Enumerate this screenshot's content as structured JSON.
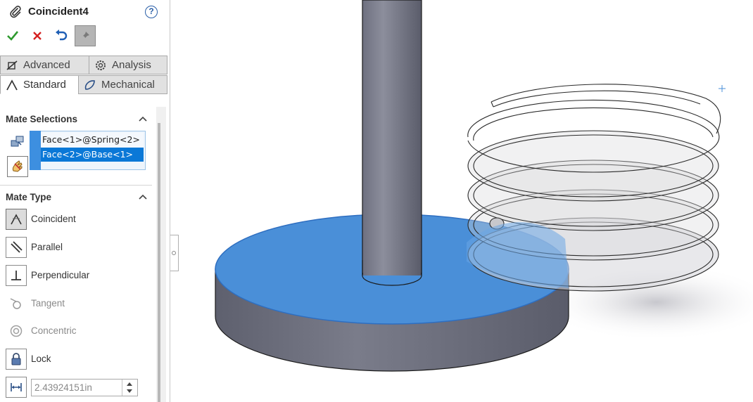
{
  "window": {
    "title": "Coincident4",
    "help_glyph": "?"
  },
  "tabs": [
    {
      "label": "Advanced"
    },
    {
      "label": "Analysis"
    },
    {
      "label": "Standard",
      "active": true
    },
    {
      "label": "Mechanical"
    }
  ],
  "mate_selections": {
    "title": "Mate Selections",
    "items": [
      {
        "text": "Face<1>@Spring<2>",
        "selected": false
      },
      {
        "text": "Face<2>@Base<1>",
        "selected": true
      }
    ]
  },
  "mate_type": {
    "title": "Mate Type",
    "options": [
      {
        "label": "Coincident",
        "active": true,
        "enabled": true
      },
      {
        "label": "Parallel",
        "active": false,
        "enabled": true
      },
      {
        "label": "Perpendicular",
        "active": false,
        "enabled": true
      },
      {
        "label": "Tangent",
        "active": false,
        "enabled": false
      },
      {
        "label": "Concentric",
        "active": false,
        "enabled": false
      },
      {
        "label": "Lock",
        "active": false,
        "enabled": true
      }
    ],
    "distance_value": "2.43924151in"
  },
  "colors": {
    "accent": "#0a78d7",
    "selected_face": "#4a8fd8",
    "ok_green": "#2e9a2e",
    "cancel_red": "#d42020"
  },
  "icons": [
    "paperclip-icon",
    "check-icon",
    "close-icon",
    "undo-icon",
    "pushpin-icon",
    "help-icon"
  ]
}
